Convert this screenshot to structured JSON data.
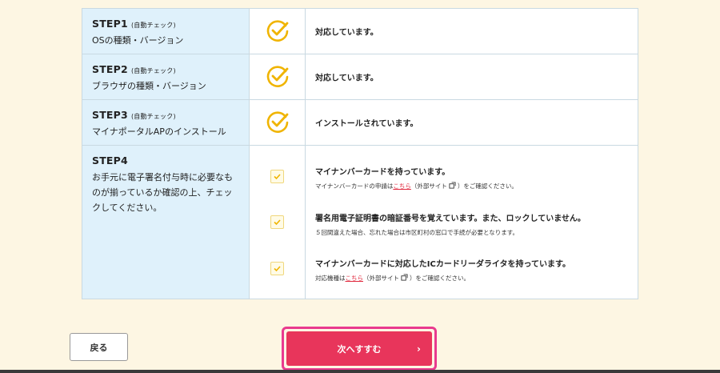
{
  "steps": [
    {
      "title": "STEP1",
      "note": "(自動チェック)",
      "desc": "OSの種類・バージョン",
      "status": "対応しています。"
    },
    {
      "title": "STEP2",
      "note": "(自動チェック)",
      "desc": "ブラウザの種類・バージョン",
      "status": "対応しています。"
    },
    {
      "title": "STEP3",
      "note": "(自動チェック)",
      "desc": "マイナポータルAPのインストール",
      "status": "インストールされています。"
    }
  ],
  "step4": {
    "title": "STEP4",
    "desc": "お手元に電子署名付与時に必要なものが揃っているか確認の上、チェックしてください。",
    "items": [
      {
        "main": "マイナンバーカードを持っています。",
        "sub_pre": "マイナンバーカードの申請は",
        "link": "こちら",
        "sub_mid": "（外部サイト",
        "sub_post": "）をご確認ください。"
      },
      {
        "main": "署名用電子証明書の暗証番号を覚えています。また、ロックしていません。",
        "sub": "５回間違えた場合、忘れた場合は市区町村の窓口で手続が必要となります。"
      },
      {
        "main": "マイナンバーカードに対応したICカードリーダライタを持っています。",
        "sub_pre": "対応機種は",
        "link": "こちら",
        "sub_mid": "（外部サイト",
        "sub_post": "）をご確認ください。"
      }
    ]
  },
  "buttons": {
    "back": "戻る",
    "next": "次へすすむ",
    "next_arrow": "›"
  },
  "colors": {
    "accent": "#e8355b",
    "check": "#f0b400",
    "step_bg": "#dff1fb",
    "page_bg": "#fdf6e3"
  },
  "icons": {
    "auto_check": "check-circle-icon",
    "checkbox": "checkbox-checked-icon",
    "external": "external-link-icon"
  }
}
